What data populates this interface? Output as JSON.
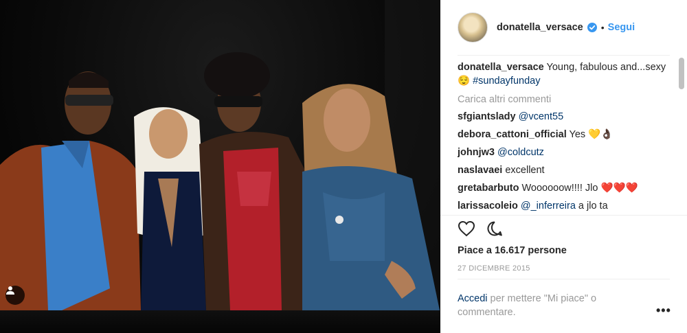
{
  "post": {
    "username": "donatella_versace",
    "dot": "•",
    "follow_label": "Segui",
    "caption_user": "donatella_versace",
    "caption_text": "Young, fabulous and...sexy 😌 ",
    "caption_tag": "#sundayfunday",
    "load_more": "Carica altri commenti",
    "likes": "Piace a 16.617 persone",
    "date": "27 DICEMBRE 2015",
    "login_link": "Accedi",
    "login_text": " per mettere \"Mi piace\" o commentare.",
    "more_label": "•••"
  },
  "comments": [
    {
      "user": "sfgiantslady",
      "pre": "",
      "tag": "@vcent55",
      "post": ""
    },
    {
      "user": "debora_cattoni_official",
      "pre": "Yes ",
      "tag": "",
      "post": "💛👌🏿"
    },
    {
      "user": "johnjw3",
      "pre": "",
      "tag": "@coldcutz",
      "post": ""
    },
    {
      "user": "naslavaei",
      "pre": "excellent",
      "tag": "",
      "post": ""
    },
    {
      "user": "gretabarbuto",
      "pre": "Woooooow!!!! Jlo ",
      "tag": "",
      "post": "❤️❤️❤️"
    },
    {
      "user": "larissacoleio",
      "pre": "",
      "tag": "@_inferreira",
      "post": " a jlo ta"
    }
  ],
  "colors": {
    "link": "#003569",
    "follow": "#3897f0",
    "muted": "#999999",
    "verified": "#3897f0"
  },
  "icons": [
    "verified-badge-icon",
    "heart-icon",
    "comment-icon",
    "user-tag-icon",
    "more-options-icon"
  ]
}
